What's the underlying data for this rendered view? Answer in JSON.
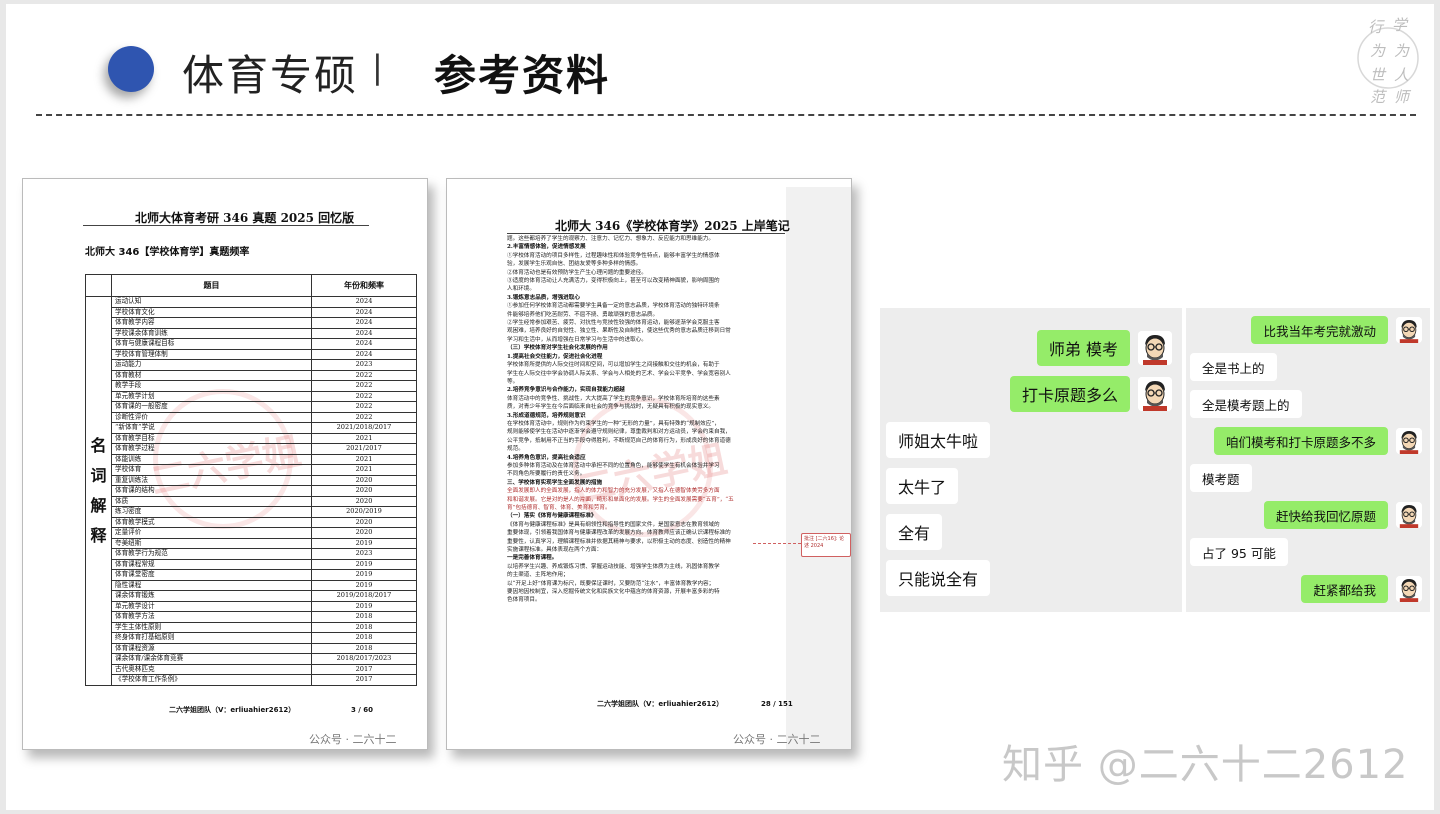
{
  "header": {
    "title_left": "体育专硕",
    "separator": "|",
    "title_right": "参考资料",
    "seal_chars": [
      "行",
      "学",
      "为",
      "为",
      "世",
      "人",
      "范",
      "师"
    ]
  },
  "doc1": {
    "title": "北师大体育考研 346 真题 2025 回忆版",
    "subtitle": "北师大 346【学校体育学】真题频率",
    "table_headers": [
      "题目",
      "年份和频率"
    ],
    "side_label": "名词解释",
    "rows": [
      [
        "运动认知",
        "2024"
      ],
      [
        "学校体育文化",
        "2024"
      ],
      [
        "体育教学内容",
        "2024"
      ],
      [
        "学校课余体育训练",
        "2024"
      ],
      [
        "体育与健康课程目标",
        "2024"
      ],
      [
        "学校体育管理体制",
        "2024"
      ],
      [
        "运动能力",
        "2023"
      ],
      [
        "体育教材",
        "2022"
      ],
      [
        "教学手段",
        "2022"
      ],
      [
        "单元教学计划",
        "2022"
      ],
      [
        "体育课的一般密度",
        "2022"
      ],
      [
        "诊断性评价",
        "2022"
      ],
      [
        "“新体育”学说",
        "2021/2018/2017"
      ],
      [
        "体育教学目标",
        "2021"
      ],
      [
        "体育教学过程",
        "2021/2017"
      ],
      [
        "体能训练",
        "2021"
      ],
      [
        "学校体育",
        "2021"
      ],
      [
        "重复训练法",
        "2020"
      ],
      [
        "体育课的结构",
        "2020"
      ],
      [
        "体质",
        "2020"
      ],
      [
        "练习密度",
        "2020/2019"
      ],
      [
        "体育教学模式",
        "2020"
      ],
      [
        "定量评价",
        "2020"
      ],
      [
        "夸美纽斯",
        "2019"
      ],
      [
        "体育教学行为规范",
        "2023"
      ],
      [
        "体育课程常规",
        "2019"
      ],
      [
        "体育课堂密度",
        "2019"
      ],
      [
        "隐性课程",
        "2019"
      ],
      [
        "课余体育锻炼",
        "2019/2018/2017"
      ],
      [
        "单元教学设计",
        "2019"
      ],
      [
        "体育教学方法",
        "2018"
      ],
      [
        "学生主体性原则",
        "2018"
      ],
      [
        "终身体育打基础原则",
        "2018"
      ],
      [
        "体育课程资源",
        "2018"
      ],
      [
        "课余体育/课余体育竞赛",
        "2018/2017/2023"
      ],
      [
        "古代奥林匹克",
        "2017"
      ],
      [
        "《学校体育工作条例》",
        "2017"
      ]
    ],
    "footer": "二六学姐团队（V：erliuahier2612）",
    "page": "3 / 60",
    "watermark": "公众号 · 二六十二",
    "stamp": "二六学姐"
  },
  "doc2": {
    "title": "北师大 346《学校体育学》2025 上岸笔记",
    "lines": [
      {
        "t": "题。这些都培养了学生的观察力、注意力、记忆力、想象力、反应能力和思维能力。",
        "s": "n"
      },
      {
        "t": "2.丰富情感体验，促进情感发展",
        "s": "h"
      },
      {
        "t": "①学校体育活动的项目多样性，过程趣味性和体验竞争性特点，能够丰富学生的情感体",
        "s": "n"
      },
      {
        "t": "验，发展学生乐观自信、团结友爱等多种多样的情感。",
        "s": "n"
      },
      {
        "t": "②体育活动也是有效预防学生产生心理问题的重要途径。",
        "s": "n"
      },
      {
        "t": "③适度的体育活动让人充满活力，变得积极向上，甚至可以改变精神面貌，影响周围的",
        "s": "n"
      },
      {
        "t": "人和环境。",
        "s": "n"
      },
      {
        "t": "3.锻炼意志品质，增强进取心",
        "s": "h"
      },
      {
        "t": "①参加任何学校体育活动都需要学生具备一定的意志品质，学校体育活动的独特环境条",
        "s": "n"
      },
      {
        "t": "件能够培养他们吃苦耐劳、不屈不挠、勇敢顽强的意志品质。",
        "s": "n"
      },
      {
        "t": "②学生经常参加艰苦、疲劳、对抗性与竞技性较强的体育运动，能够逐渐学会克服主客",
        "s": "n"
      },
      {
        "t": "观困难，培养良好的自觉性、独立性、果断性及自制性，使这些优秀的意志品质迁移到日常",
        "s": "n"
      },
      {
        "t": "学习和生活中，从而增强在日常学习与生活中的进取心。",
        "s": "n"
      },
      {
        "t": "（三）学校体育对学生社会化发展的作用",
        "s": "h"
      },
      {
        "t": "1.提高社会交往能力，促进社会化进程",
        "s": "h"
      },
      {
        "t": "学校体育所提供的人际交往时间和空间，可以增加学生之间接触和交往的机会，有助于",
        "s": "n"
      },
      {
        "t": "学生在人际交往中学会协调人际关系、学会与人相处的艺术、学会公平竞争、学会宽容别人",
        "s": "n"
      },
      {
        "t": "等。",
        "s": "n"
      },
      {
        "t": "2.培养竞争意识与合作能力，实现自我能力超越",
        "s": "h"
      },
      {
        "t": "体育活动中的竞争性、挑战性，大大提高了学生的竞争意识，学校体育所培育的这些素",
        "s": "n"
      },
      {
        "t": "质，对青少年学生在今后面临来自社会的竞争与挑战时，无疑具有积极的现实意义。",
        "s": "n"
      },
      {
        "t": "3.形成道德规范，培养规则意识",
        "s": "h"
      },
      {
        "t": "在学校体育活动中，规则作为约束学生的一种“无形的力量”，具有特殊的“规制效应”，",
        "s": "n"
      },
      {
        "t": "规则能够使学生在活动中逐渐学会遵守规则纪律，尊重裁判和对方运动员，学会约束自我，",
        "s": "n"
      },
      {
        "t": "公平竞争，抵制用不正当的手段夺得胜利，不断规范自己的体育行为，形成良好的体育道德",
        "s": "n"
      },
      {
        "t": "规范。",
        "s": "n"
      },
      {
        "t": "4.培养角色意识，提高社会适应",
        "s": "h"
      },
      {
        "t": "参加多种体育活动及在体育活动中承担不同的位置角色，能够使学生有机会体验并学习",
        "s": "n"
      },
      {
        "t": "不同角色所要履行的责任义务。",
        "s": "n"
      },
      {
        "t": "三、学校体育实现学生全面发展的措施",
        "s": "h"
      },
      {
        "t": "全面发展即人的全面发展，指人的体力和智力的充分发展，又指人在德智体美劳多方面",
        "s": "r"
      },
      {
        "t": "和和谐发展。它是对的是人的片面，畸形和单面化的发展。学生的全面发展需要“五育”，“五",
        "s": "r"
      },
      {
        "t": "育”包括德育、智育、体育、美育和劳育。",
        "s": "r"
      },
      {
        "t": "（一）落实《体育与健康课程标准》",
        "s": "h"
      },
      {
        "t": "《体育与健康课程标准》是具有纲领性和指导性的国家文件，是国家意志在教育领域的",
        "s": "n"
      },
      {
        "t": "重要体现，引领着我国体育与健康课程改革的发展方向。体育教师应该正确认识课程标准的",
        "s": "n"
      },
      {
        "t": "重要性，认真学习，理解课程标准并依据其精神与要求，以积极主动的态度、创造性的精神",
        "s": "n"
      },
      {
        "t": "实施课程标准。具体表现在两个方面：",
        "s": "n"
      },
      {
        "t": "一是完善体育课程。",
        "s": "h"
      },
      {
        "t": "以培养学生兴趣、养成锻炼习惯、掌握运动技能、增强学生体质为主线，巩固体育教学",
        "s": "n"
      },
      {
        "t": "的主渠道、主阵地作用；",
        "s": "n"
      },
      {
        "t": "以“开足上好”体育课为标尺，既要保证课时，又要防范“注水”，丰富体育教学内容；",
        "s": "n"
      },
      {
        "t": "要因地因校制宜，深入挖掘传统文化和民族文化中蕴含的体育资源，开展丰富多彩的特",
        "s": "n"
      },
      {
        "t": "色体育项目。",
        "s": "n"
      }
    ],
    "comment": "批注 [二六16]: 论述 2024",
    "footer": "二六学姐团队（V：erliuahier2612）",
    "page": "28 / 151",
    "watermark": "公众号 · 二六十二",
    "stamp": "二六学姐"
  },
  "chat_left": [
    {
      "side": "right",
      "text": "师弟 模考"
    },
    {
      "side": "right",
      "text": "打卡原题多么"
    },
    {
      "side": "left",
      "text": "师姐太牛啦"
    },
    {
      "side": "left",
      "text": "太牛了"
    },
    {
      "side": "left",
      "text": "全有"
    },
    {
      "side": "left",
      "text": "只能说全有"
    }
  ],
  "chat_right": [
    {
      "side": "right",
      "text": "比我当年考完就激动"
    },
    {
      "side": "left",
      "text": "全是书上的"
    },
    {
      "side": "left",
      "text": "全是模考题上的"
    },
    {
      "side": "right",
      "text": "咱们模考和打卡原题多不多"
    },
    {
      "side": "left",
      "text": "模考题"
    },
    {
      "side": "right",
      "text": "赶快给我回忆原题"
    },
    {
      "side": "left",
      "text": "占了 95 可能"
    },
    {
      "side": "right",
      "text": "赶紧都给我"
    }
  ],
  "watermark": "知乎 @二六十二2612"
}
